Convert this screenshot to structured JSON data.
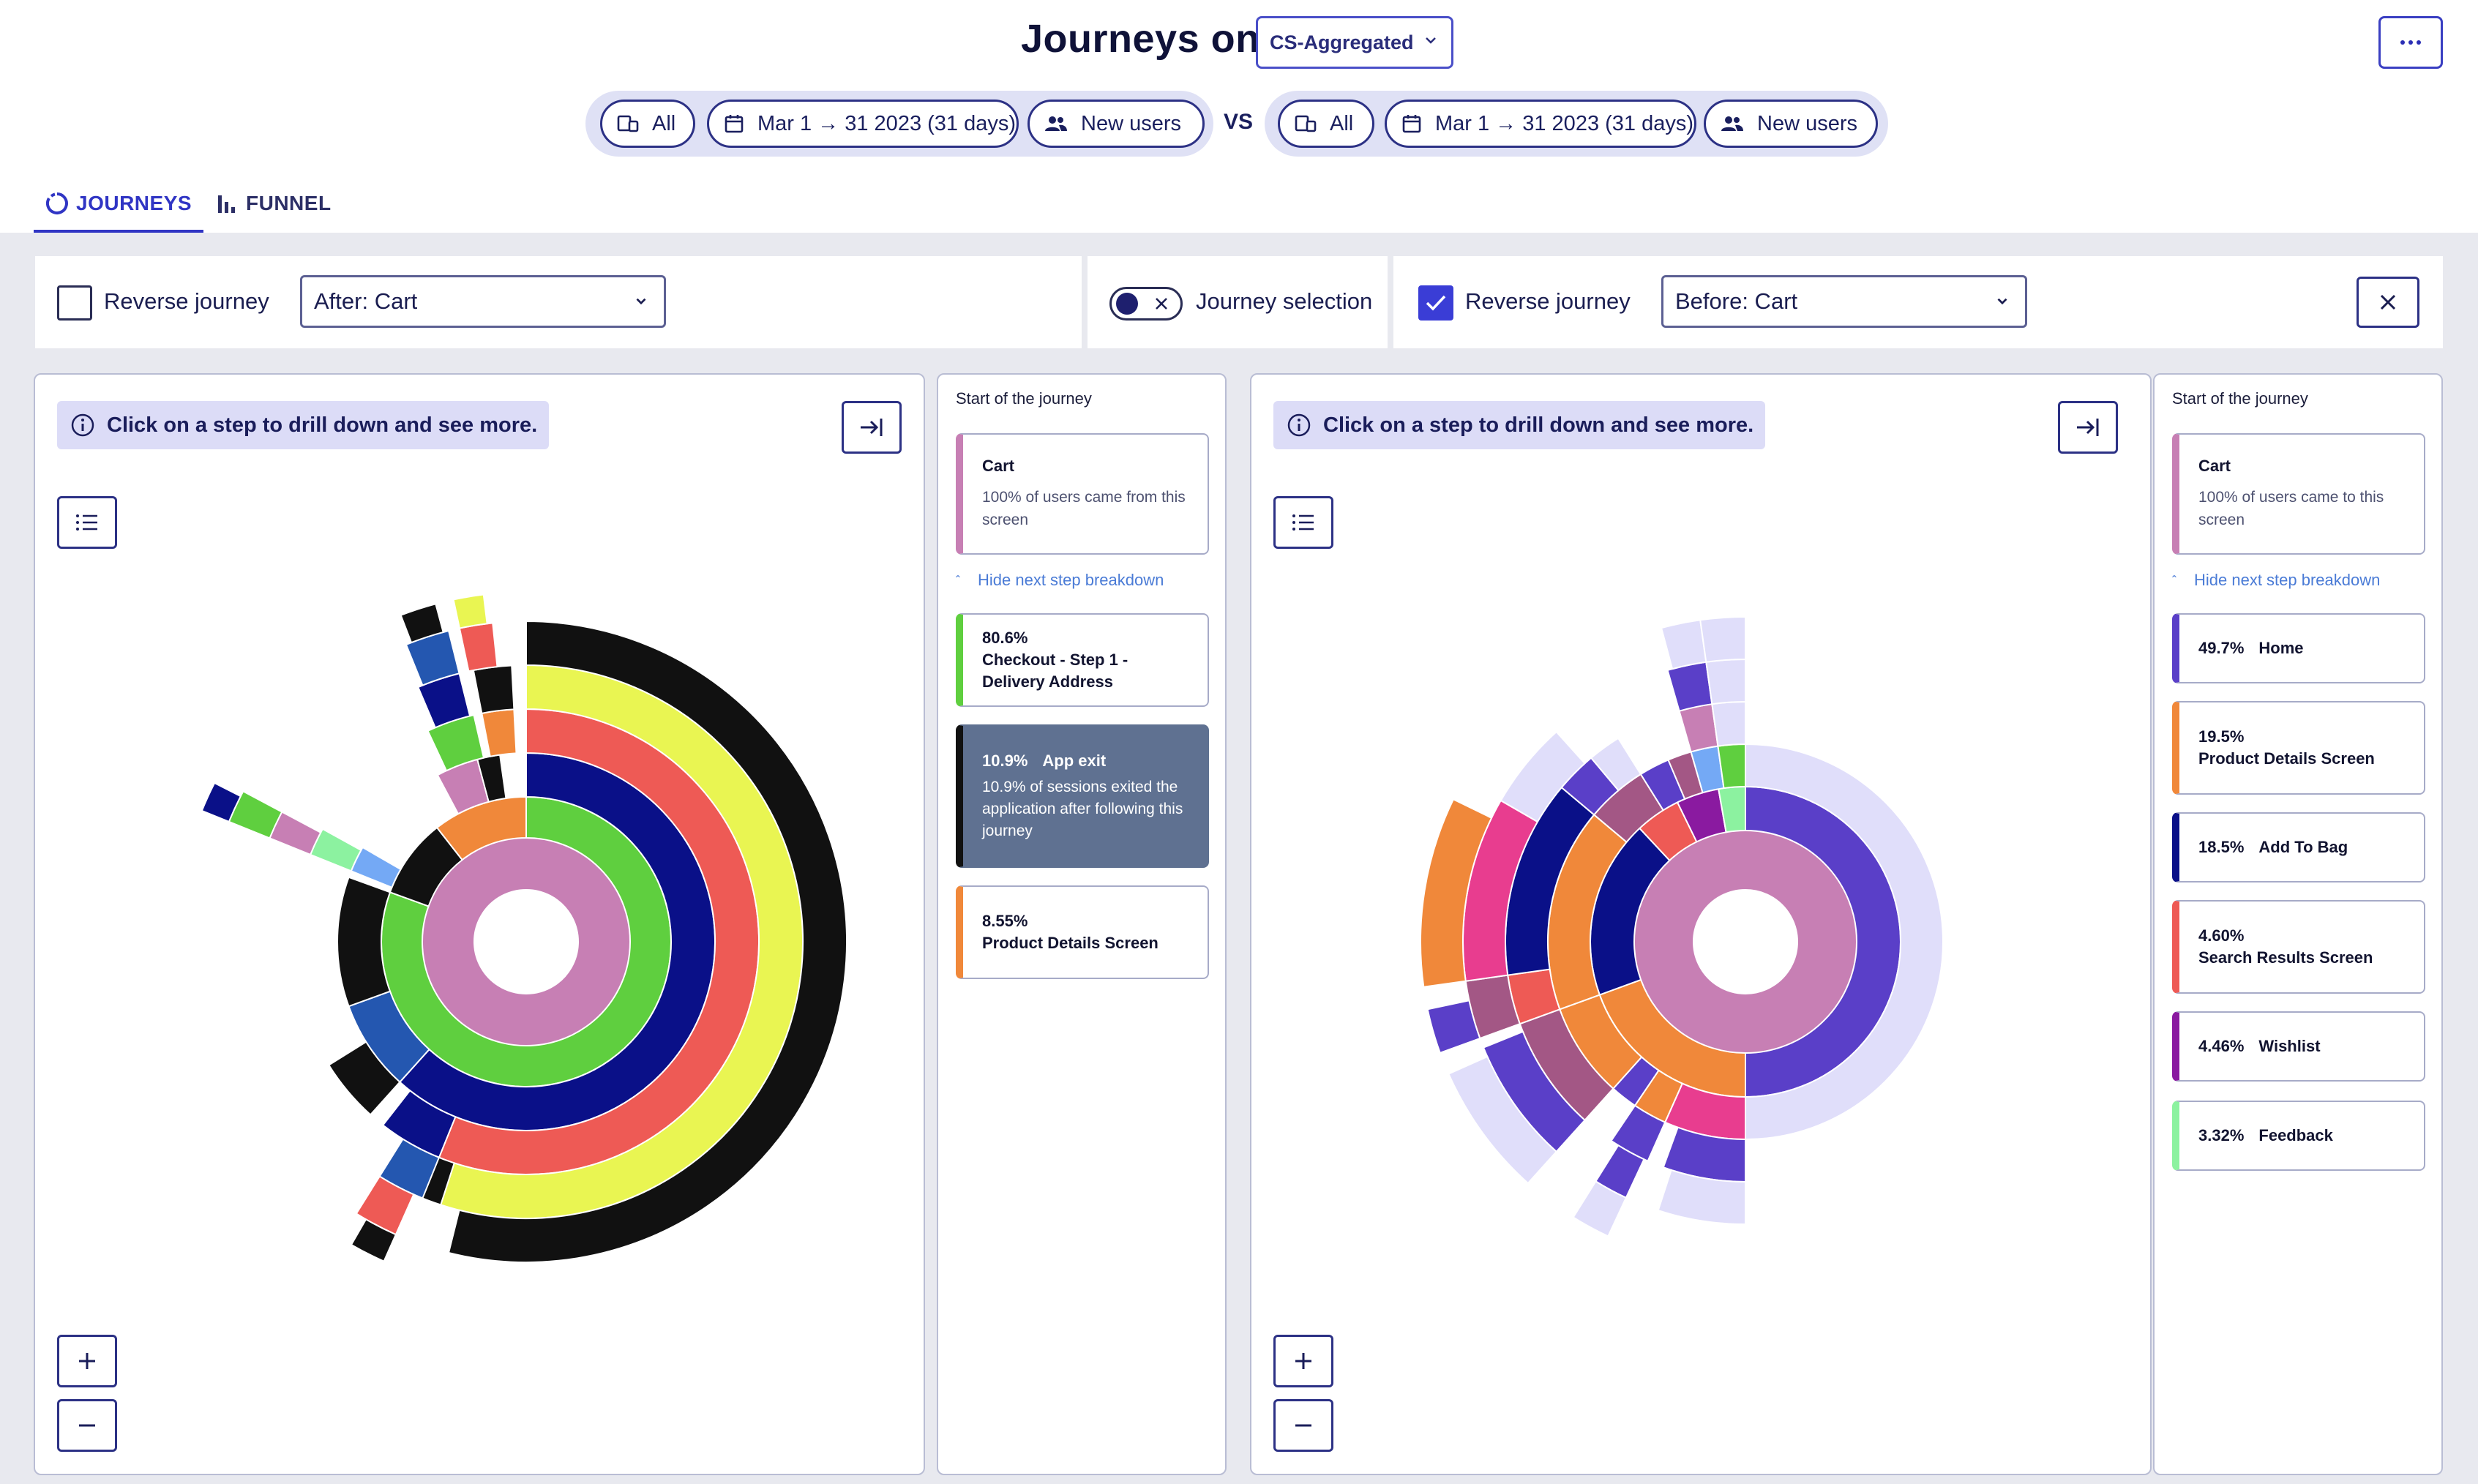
{
  "header": {
    "title": "Journeys on",
    "dataset": "CS-Aggregated",
    "vs": "VS"
  },
  "segments": [
    {
      "device": "All",
      "date_range": "Mar 1 → 31 2023 (31 days)",
      "audience": "New users"
    },
    {
      "device": "All",
      "date_range": "Mar 1 → 31 2023 (31 days)",
      "audience": "New users"
    }
  ],
  "tabs": [
    {
      "label": "JOURNEYS"
    },
    {
      "label": "FUNNEL"
    }
  ],
  "controls": {
    "left": {
      "reverse_label": "Reverse journey",
      "reverse_checked": false,
      "step_select": "After: Cart"
    },
    "middle": {
      "toggle_label": "Journey selection"
    },
    "right": {
      "reverse_label": "Reverse journey",
      "reverse_checked": true,
      "step_select": "Before: Cart"
    }
  },
  "hint": "Click on a step to drill down and see more.",
  "left_panel": {
    "start_title": "Start of the journey",
    "start_card": {
      "name": "Cart",
      "desc": "100% of users came from this screen",
      "color": "#c77fb4"
    },
    "hide_link": "Hide next step breakdown",
    "steps": [
      {
        "pct": "80.6%",
        "name": "Checkout - Step 1 - Delivery Address",
        "color": "#5fcf3f"
      },
      {
        "pct": "10.9%",
        "name": "App exit",
        "desc": "10.9% of sessions exited the application after following this journey",
        "color": "#111111"
      },
      {
        "pct": "8.55%",
        "name": "Product Details Screen",
        "color": "#f0883a"
      }
    ]
  },
  "right_panel": {
    "start_title": "Start of the journey",
    "start_card": {
      "name": "Cart",
      "desc": "100% of users came to this screen",
      "color": "#c77fb4"
    },
    "hide_link": "Hide next step breakdown",
    "steps": [
      {
        "pct": "49.7%",
        "name": "Home",
        "color": "#5a3fc8"
      },
      {
        "pct": "19.5%",
        "name": "Product Details Screen",
        "color": "#f0883a"
      },
      {
        "pct": "18.5%",
        "name": "Add To Bag",
        "color": "#0a1088"
      },
      {
        "pct": "4.60%",
        "name": "Search Results Screen",
        "color": "#ee5a55"
      },
      {
        "pct": "4.46%",
        "name": "Wishlist",
        "color": "#8a1aa0"
      },
      {
        "pct": "3.32%",
        "name": "Feedback",
        "color": "#8cf2a0"
      }
    ]
  },
  "icons": {
    "device": "devices-icon",
    "date": "calendar-icon",
    "audience": "users-icon",
    "tab_journeys": "donut-icon",
    "tab_funnel": "bar-chart-icon",
    "info": "info-icon",
    "expand": "expand-icon",
    "list": "list-icon",
    "zoom_in": "plus-icon",
    "zoom_out": "minus-icon",
    "close": "close-icon",
    "more": "more-icon"
  },
  "colors": {
    "accent": "#3035c4",
    "cart": "#c77fb4",
    "checkout": "#5fcf3f",
    "add_to_bag": "#0a1088",
    "search": "#ee5a55",
    "yellow": "#e9f552",
    "exit": "#111111",
    "product": "#f0883a",
    "home": "#5a3fc8",
    "wishlist": "#8a1aa0",
    "feedback": "#8cf2a0",
    "light_blue": "#74a9f5",
    "mid_blue": "#2457b0",
    "pink": "#e83d8f",
    "mauve": "#a35785",
    "lavender": "#e0defa"
  }
}
